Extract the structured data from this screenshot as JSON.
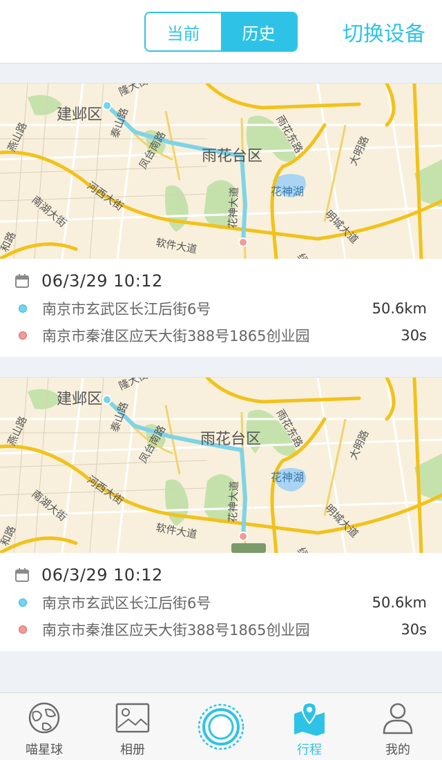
{
  "header": {
    "segment": [
      "当前",
      "历史"
    ],
    "active_segment": 1,
    "switch_device": "切换设备"
  },
  "trips": [
    {
      "map_labels": {
        "d1": "建邺区",
        "d2": "雨花台区",
        "lake": "花神湖",
        "r1": "燕山路",
        "r2": "河西大街",
        "r3": "南湖大街",
        "r4": "软件大道",
        "r5": "凤台南路",
        "r6": "雨花东路",
        "r7": "明城大道",
        "r8": "大明路",
        "r9": "泰山路",
        "r10": "花神大道",
        "r11": "隆大街",
        "r12": "和路",
        "r13": "绿"
      },
      "date": "06/3/29  10:12",
      "start": "南京市玄武区长江后街6号",
      "distance": "50.6km",
      "end": "南京市秦淮区应天大街388号1865创业园",
      "duration": "30s"
    },
    {
      "map_labels": {
        "d1": "建邺区",
        "d2": "雨花台区",
        "lake": "花神湖",
        "r1": "燕山路",
        "r2": "河西大街",
        "r3": "南湖大街",
        "r4": "软件大道",
        "r5": "凤台南路",
        "r6": "雨花东路",
        "r7": "明城大道",
        "r8": "大明路",
        "r9": "泰山路",
        "r10": "花神大道",
        "r11": "隆大街",
        "r12": "和路",
        "r13": "绿"
      },
      "date": "06/3/29  10:12",
      "start": "南京市玄武区长江后街6号",
      "distance": "50.6km",
      "end": "南京市秦淮区应天大街388号1865创业园",
      "duration": "30s"
    }
  ],
  "tabs": [
    {
      "label": "喵星球",
      "icon": "planet-icon"
    },
    {
      "label": "相册",
      "icon": "photo-album-icon"
    },
    {
      "label": "",
      "icon": "center-circle-icon"
    },
    {
      "label": "行程",
      "icon": "map-pin-icon"
    },
    {
      "label": "我的",
      "icon": "user-icon"
    }
  ],
  "active_tab": 3,
  "colors": {
    "accent": "#2ec3e6",
    "start_dot": "#6ed6ef",
    "end_dot": "#f29a98",
    "route": "#7fd3e6",
    "major_road": "#f2c21b"
  }
}
